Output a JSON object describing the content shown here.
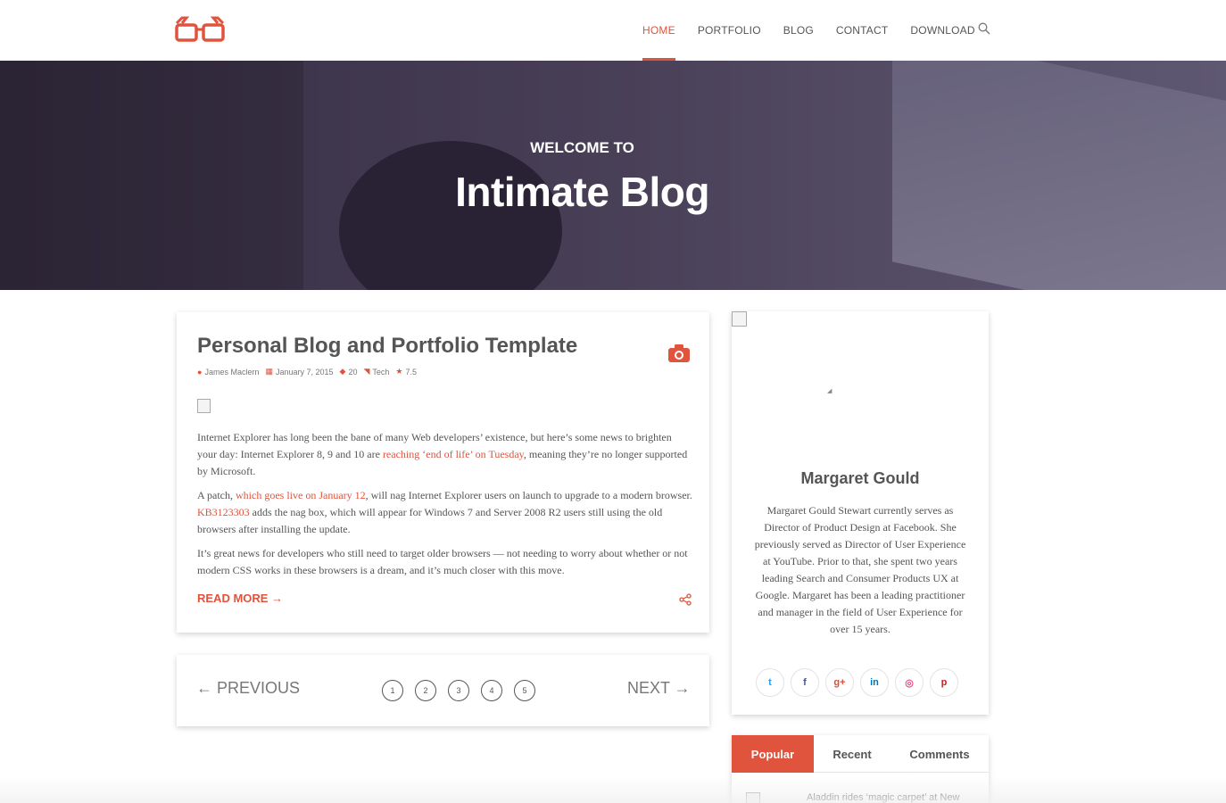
{
  "nav": {
    "items": [
      {
        "label": "HOME",
        "active": true
      },
      {
        "label": "PORTFOLIO",
        "active": false
      },
      {
        "label": "BLOG",
        "active": false
      },
      {
        "label": "CONTACT",
        "active": false
      },
      {
        "label": "DOWNLOAD",
        "active": false
      }
    ],
    "search_icon": "search-icon",
    "logo_icon": "glasses-icon"
  },
  "hero": {
    "subtitle": "WELCOME TO",
    "title": "Intimate Blog"
  },
  "post": {
    "title": "Personal Blog and Portfolio Template",
    "meta": {
      "author": "James Maclern",
      "date": "January 7, 2015",
      "comments": "20",
      "tag": "Tech",
      "rating": "7.5"
    },
    "paragraphs": [
      {
        "parts": [
          {
            "text": "Internet Explorer has long been the bane of many Web developers’ existence, but here’s some news to brighten your day: Internet Explorer 8, 9 and 10 are "
          },
          {
            "text": "reaching ‘end of life’ on Tuesday",
            "link": true
          },
          {
            "text": ", meaning they’re no longer supported by Microsoft."
          }
        ]
      },
      {
        "parts": [
          {
            "text": "A patch, "
          },
          {
            "text": "which goes live on January 12",
            "link": true
          },
          {
            "text": ", will nag Internet Explorer users on launch to upgrade to a modern browser. "
          },
          {
            "text": "KB3123303",
            "link": true
          },
          {
            "text": " adds the nag box, which will appear for Windows 7 and Server 2008 R2 users still using the old browsers after installing the update."
          }
        ]
      },
      {
        "parts": [
          {
            "text": "It’s great news for developers who still need to target older browsers — not needing to worry about whether or not modern CSS works in these browsers is a dream, and it’s much closer with this move."
          }
        ]
      }
    ],
    "read_more": "READ MORE →"
  },
  "pagination": {
    "prev": "← PREVIOUS",
    "next": "NEXT →",
    "pages": [
      "1",
      "2",
      "3",
      "4",
      "5"
    ]
  },
  "author": {
    "name": "Margaret Gould",
    "bio": "Margaret Gould Stewart currently serves as Director of Product Design at Facebook. She previously served as Director of User Experience at YouTube. Prior to that, she spent two years leading Search and Consumer Products UX at Google. Margaret has been a leading practitioner and manager in the field of User Experience for over 15 years.",
    "socials": [
      {
        "icon": "twitter-icon",
        "glyph": "t",
        "color": "#1da1f2"
      },
      {
        "icon": "facebook-icon",
        "glyph": "f",
        "color": "#3b5998"
      },
      {
        "icon": "google-plus-icon",
        "glyph": "g+",
        "color": "#dd4b39"
      },
      {
        "icon": "linkedin-icon",
        "glyph": "in",
        "color": "#0077b5"
      },
      {
        "icon": "dribbble-icon",
        "glyph": "◎",
        "color": "#ea4c89"
      },
      {
        "icon": "pinterest-icon",
        "glyph": "p",
        "color": "#cb2027"
      }
    ]
  },
  "widget_tabs": {
    "tabs": [
      {
        "label": "Popular",
        "active": true
      },
      {
        "label": "Recent",
        "active": false
      },
      {
        "label": "Comments",
        "active": false
      }
    ],
    "first_item": "Aladdin rides ‘magic carpet’ at New"
  },
  "colors": {
    "accent": "#e0533c",
    "text": "#555555"
  }
}
